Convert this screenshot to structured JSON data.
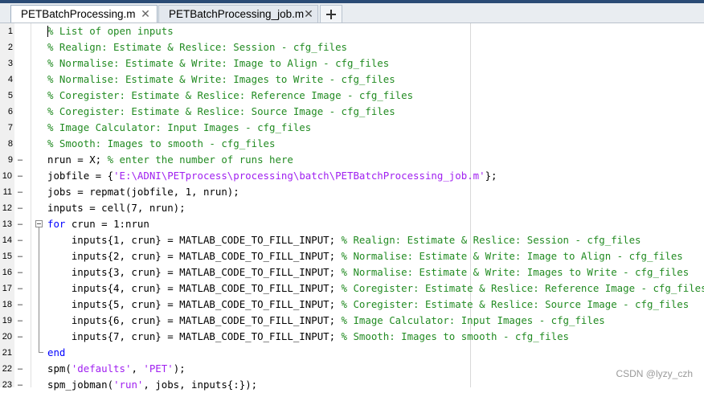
{
  "tabs": [
    {
      "label": "PETBatchProcessing.m",
      "active": true,
      "close_icon": "close-icon"
    },
    {
      "label": "PETBatchProcessing_job.m",
      "active": false,
      "close_icon": "close-icon"
    }
  ],
  "add_tab_icon": "plus-icon",
  "colors": {
    "comment": "#228b22",
    "string": "#a020f0",
    "keyword": "#0000ff",
    "tab_strip": "#2a4b75"
  },
  "breakpoint_marker": "–",
  "lines": [
    {
      "n": "1",
      "bp": false,
      "segs": [
        {
          "t": "% List of open inputs",
          "c": "comment"
        }
      ]
    },
    {
      "n": "2",
      "bp": false,
      "segs": [
        {
          "t": "% Realign: Estimate & Reslice: Session - cfg_files",
          "c": "comment"
        }
      ]
    },
    {
      "n": "3",
      "bp": false,
      "segs": [
        {
          "t": "% Normalise: Estimate & Write: Image to Align - cfg_files",
          "c": "comment"
        }
      ]
    },
    {
      "n": "4",
      "bp": false,
      "segs": [
        {
          "t": "% Normalise: Estimate & Write: Images to Write - cfg_files",
          "c": "comment"
        }
      ]
    },
    {
      "n": "5",
      "bp": false,
      "segs": [
        {
          "t": "% Coregister: Estimate & Reslice: Reference Image - cfg_files",
          "c": "comment"
        }
      ]
    },
    {
      "n": "6",
      "bp": false,
      "segs": [
        {
          "t": "% Coregister: Estimate & Reslice: Source Image - cfg_files",
          "c": "comment"
        }
      ]
    },
    {
      "n": "7",
      "bp": false,
      "segs": [
        {
          "t": "% Image Calculator: Input Images - cfg_files",
          "c": "comment"
        }
      ]
    },
    {
      "n": "8",
      "bp": false,
      "segs": [
        {
          "t": "% Smooth: Images to smooth - cfg_files",
          "c": "comment"
        }
      ]
    },
    {
      "n": "9",
      "bp": true,
      "segs": [
        {
          "t": "nrun = X; ",
          "c": "plain"
        },
        {
          "t": "% enter the number of runs here",
          "c": "comment"
        }
      ]
    },
    {
      "n": "10",
      "bp": true,
      "segs": [
        {
          "t": "jobfile = {",
          "c": "plain"
        },
        {
          "t": "'E:\\ADNI\\PETprocess\\processing\\batch\\PETBatchProcessing_job.m'",
          "c": "string"
        },
        {
          "t": "};",
          "c": "plain"
        }
      ]
    },
    {
      "n": "11",
      "bp": true,
      "segs": [
        {
          "t": "jobs = repmat(jobfile, 1, nrun);",
          "c": "plain"
        }
      ]
    },
    {
      "n": "12",
      "bp": true,
      "segs": [
        {
          "t": "inputs = cell(7, nrun);",
          "c": "plain"
        }
      ]
    },
    {
      "n": "13",
      "bp": true,
      "fold": "open",
      "segs": [
        {
          "t": "for",
          "c": "keyword"
        },
        {
          "t": " crun = 1:nrun",
          "c": "plain"
        }
      ]
    },
    {
      "n": "14",
      "bp": true,
      "segs": [
        {
          "t": "    inputs{1, crun} = MATLAB_CODE_TO_FILL_INPUT; ",
          "c": "plain"
        },
        {
          "t": "% Realign: Estimate & Reslice: Session - cfg_files",
          "c": "comment"
        }
      ]
    },
    {
      "n": "15",
      "bp": true,
      "segs": [
        {
          "t": "    inputs{2, crun} = MATLAB_CODE_TO_FILL_INPUT; ",
          "c": "plain"
        },
        {
          "t": "% Normalise: Estimate & Write: Image to Align - cfg_files",
          "c": "comment"
        }
      ]
    },
    {
      "n": "16",
      "bp": true,
      "segs": [
        {
          "t": "    inputs{3, crun} = MATLAB_CODE_TO_FILL_INPUT; ",
          "c": "plain"
        },
        {
          "t": "% Normalise: Estimate & Write: Images to Write - cfg_files",
          "c": "comment"
        }
      ]
    },
    {
      "n": "17",
      "bp": true,
      "segs": [
        {
          "t": "    inputs{4, crun} = MATLAB_CODE_TO_FILL_INPUT; ",
          "c": "plain"
        },
        {
          "t": "% Coregister: Estimate & Reslice: Reference Image - cfg_files",
          "c": "comment"
        }
      ]
    },
    {
      "n": "18",
      "bp": true,
      "segs": [
        {
          "t": "    inputs{5, crun} = MATLAB_CODE_TO_FILL_INPUT; ",
          "c": "plain"
        },
        {
          "t": "% Coregister: Estimate & Reslice: Source Image - cfg_files",
          "c": "comment"
        }
      ]
    },
    {
      "n": "19",
      "bp": true,
      "segs": [
        {
          "t": "    inputs{6, crun} = MATLAB_CODE_TO_FILL_INPUT; ",
          "c": "plain"
        },
        {
          "t": "% Image Calculator: Input Images - cfg_files",
          "c": "comment"
        }
      ]
    },
    {
      "n": "20",
      "bp": true,
      "segs": [
        {
          "t": "    inputs{7, crun} = MATLAB_CODE_TO_FILL_INPUT; ",
          "c": "plain"
        },
        {
          "t": "% Smooth: Images to smooth - cfg_files",
          "c": "comment"
        }
      ]
    },
    {
      "n": "21",
      "bp": false,
      "fold": "end",
      "segs": [
        {
          "t": "end",
          "c": "keyword"
        }
      ]
    },
    {
      "n": "22",
      "bp": true,
      "segs": [
        {
          "t": "spm(",
          "c": "plain"
        },
        {
          "t": "'defaults'",
          "c": "string"
        },
        {
          "t": ", ",
          "c": "plain"
        },
        {
          "t": "'PET'",
          "c": "string"
        },
        {
          "t": ");",
          "c": "plain"
        }
      ]
    },
    {
      "n": "23",
      "bp": true,
      "segs": [
        {
          "t": "spm_jobman(",
          "c": "plain"
        },
        {
          "t": "'run'",
          "c": "string"
        },
        {
          "t": ", jobs, inputs{:});",
          "c": "plain"
        }
      ]
    }
  ],
  "watermark": "CSDN @lyzy_czh"
}
